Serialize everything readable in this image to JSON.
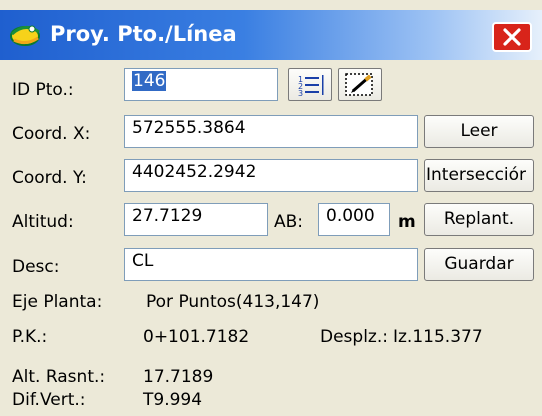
{
  "window": {
    "title": "Proy. Pto./Línea"
  },
  "form": {
    "id_label": "ID Pto.:",
    "id_value": "146",
    "x_label": "Coord. X:",
    "x_value": "572555.3864",
    "y_label": "Coord. Y:",
    "y_value": "4402452.2942",
    "alt_label": "Altitud:",
    "alt_value": "27.7129",
    "ab_label": "AB:",
    "ab_value": "0.000",
    "ab_unit": "m",
    "desc_label": "Desc:",
    "desc_value": "CL"
  },
  "buttons": {
    "leer": "Leer",
    "interseccion": "Intersecciór",
    "replant": "Replant.",
    "guardar": "Guardar"
  },
  "info": {
    "eje_label": "Eje Planta:",
    "eje_value": "Por Puntos(413,147)",
    "pk_label": "P.K.:",
    "pk_value": "0+101.7182",
    "desplz_label": "Desplz.:",
    "desplz_value": "Iz.115.377",
    "alt_rasnt_label": "Alt. Rasnt.:",
    "alt_rasnt_value": "17.7189",
    "dif_vert_label": "Dif.Vert.:",
    "dif_vert_value": "T9.994"
  },
  "icons": {
    "app": "survey-app-icon",
    "list": "numbered-list-icon",
    "map": "map-pick-icon",
    "close": "close-icon"
  },
  "colors": {
    "title_start": "#1f5fcf",
    "close_red": "#d8241a",
    "selection": "#316ac5",
    "window_bg": "#ece9d8"
  }
}
